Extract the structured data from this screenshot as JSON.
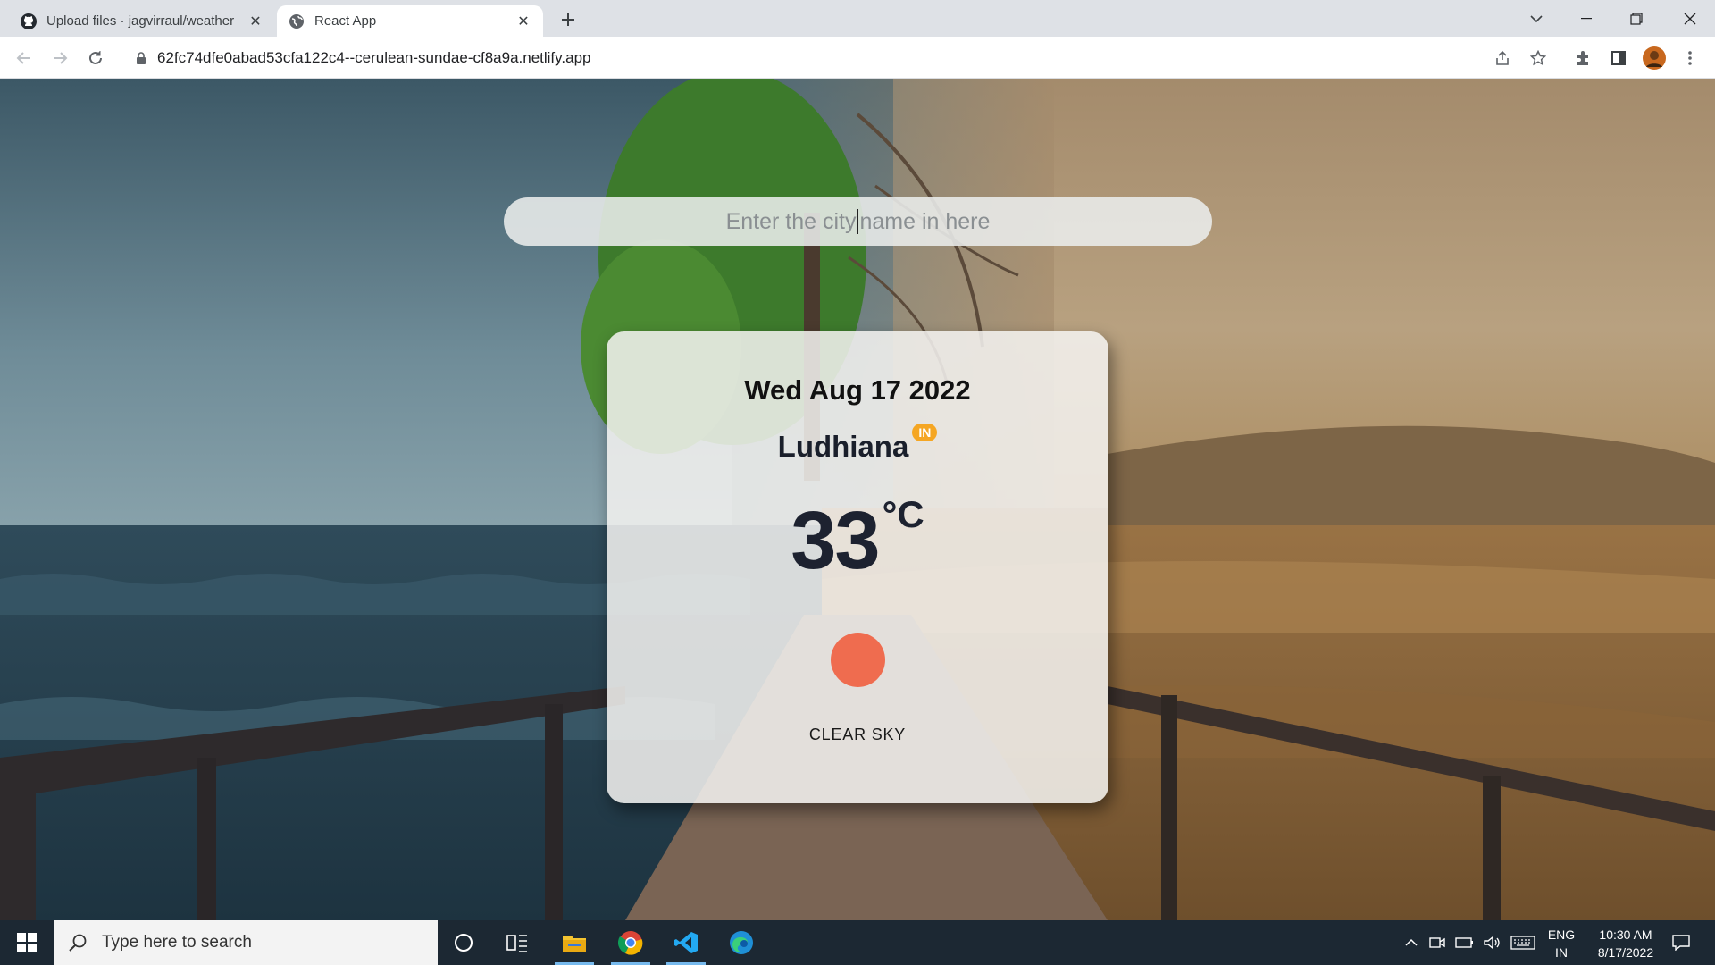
{
  "browser": {
    "tabs": [
      {
        "title": "Upload files · jagvirraul/weather",
        "favicon": "github-icon",
        "active": false
      },
      {
        "title": "React App",
        "favicon": "globe-icon",
        "active": true
      }
    ],
    "url": "62fc74dfe0abad53cfa122c4--cerulean-sundae-cf8a9a.netlify.app"
  },
  "app": {
    "search": {
      "placeholder_before": "Enter the city",
      "placeholder_after": "name in here"
    },
    "date": "Wed Aug 17 2022",
    "city": "Ludhiana",
    "country": "IN",
    "temperature": "33",
    "unit": "°C",
    "description": "CLEAR SKY",
    "weather_icon": "sun-icon",
    "colors": {
      "sun": "#ef6c4f",
      "badge": "#f5a623"
    }
  },
  "taskbar": {
    "search_placeholder": "Type here to search",
    "apps": [
      "cortana-icon",
      "task-view-icon",
      "file-explorer-icon",
      "chrome-icon",
      "vscode-icon",
      "edge-icon"
    ],
    "lang_top": "ENG",
    "lang_bottom": "IN",
    "time": "10:30 AM",
    "date": "8/17/2022"
  }
}
